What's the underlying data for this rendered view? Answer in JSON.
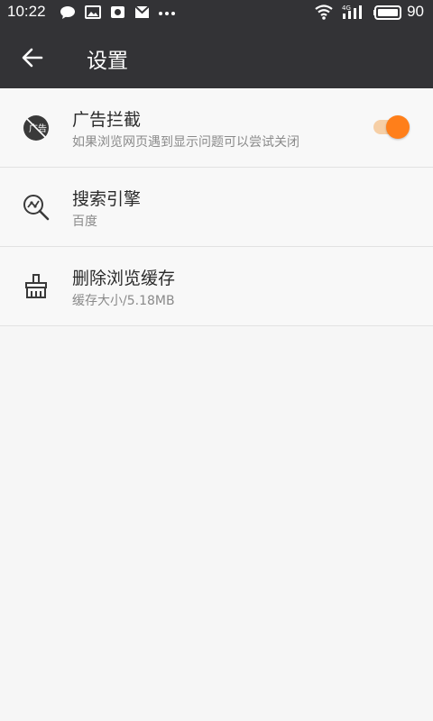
{
  "status_bar": {
    "time": "10:22",
    "battery": "90",
    "icons": [
      "chat-bubble-icon",
      "image-notification-icon",
      "app-notification-icon",
      "mail-icon",
      "more-dots-icon",
      "wifi-icon",
      "signal-4g-icon",
      "battery-icon"
    ]
  },
  "app_bar": {
    "title": "设置",
    "back_icon": "arrow-left-icon"
  },
  "settings": [
    {
      "title": "广告拦截",
      "subtitle": "如果浏览网页遇到显示问题可以尝试关闭",
      "icon": "ad-block-icon",
      "toggle_on": true
    },
    {
      "title": "搜索引擎",
      "subtitle": "百度",
      "icon": "search-engine-icon"
    },
    {
      "title": "删除浏览缓存",
      "subtitle": "缓存大小/5.18MB",
      "icon": "clear-cache-icon"
    }
  ],
  "colors": {
    "header_bg": "#333336",
    "accent": "#ff7f1a",
    "background": "#f6f6f6"
  }
}
